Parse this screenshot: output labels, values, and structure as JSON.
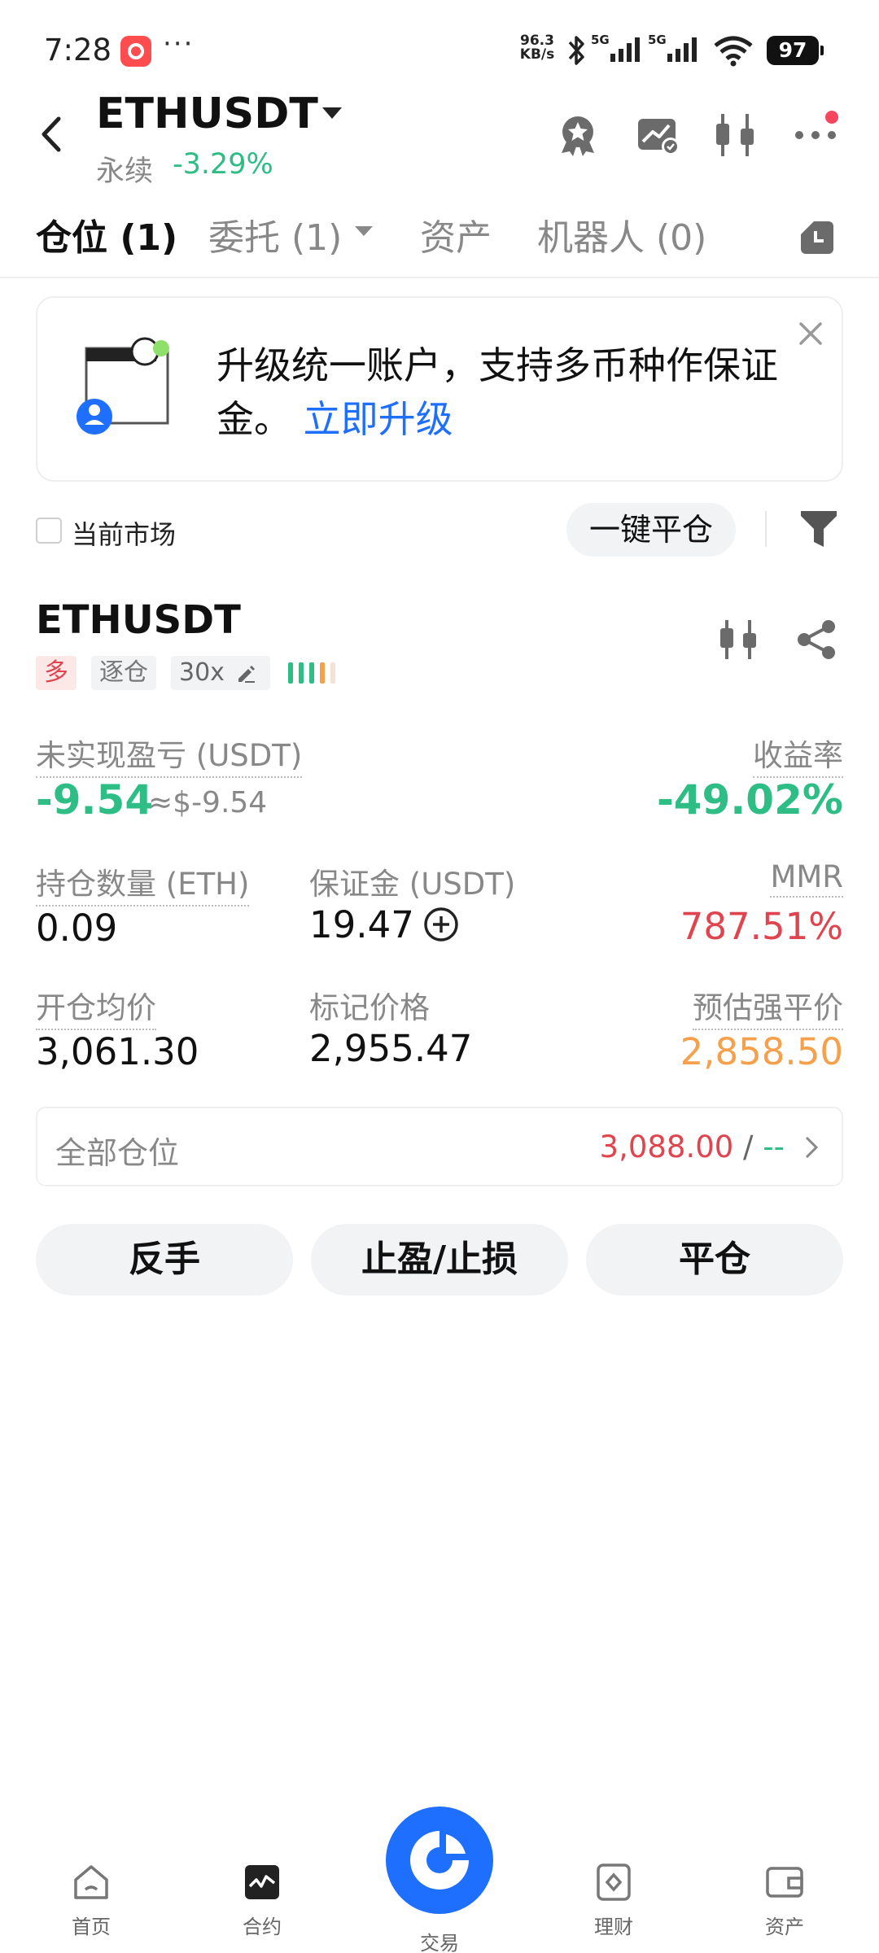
{
  "status_bar": {
    "time": "7:28",
    "more": "···",
    "net_speed_value": "96.3",
    "net_speed_unit": "KB/s",
    "signal_1": "5G",
    "signal_2": "5G",
    "battery": "97"
  },
  "header": {
    "symbol": "ETHUSDT",
    "contract_type": "永续",
    "change": "-3.29%",
    "icons": [
      "award-icon",
      "chart-trend-icon",
      "candlestick-icon",
      "more-icon"
    ]
  },
  "tabs": [
    {
      "label": "仓位 (1)",
      "active": true
    },
    {
      "label": "委托 (1)",
      "active": false
    },
    {
      "label": "资产",
      "active": false
    },
    {
      "label": "机器人 (0)",
      "active": false
    }
  ],
  "banner": {
    "text": "升级统一账户，支持多币种作保证金。",
    "link": "立即升级"
  },
  "filter": {
    "current_market": "当前市场",
    "close_all": "一键平仓"
  },
  "position": {
    "symbol": "ETHUSDT",
    "side": "多",
    "margin_mode": "逐仓",
    "leverage": "30x",
    "risk_level": 4,
    "unrealized_pnl_label": "未实现盈亏 (USDT)",
    "unrealized_pnl": "-9.54",
    "unrealized_pnl_usd": "≈$-9.54",
    "roe_label": "收益率",
    "roe": "-49.02%",
    "size_label": "持仓数量 (ETH)",
    "size": "0.09",
    "margin_label": "保证金 (USDT)",
    "margin": "19.47",
    "mmr_label": "MMR",
    "mmr": "787.51%",
    "entry_label": "开仓均价",
    "entry": "3,061.30",
    "mark_label": "标记价格",
    "mark": "2,955.47",
    "liq_label": "预估强平价",
    "liq": "2,858.50",
    "all_positions_label": "全部仓位",
    "all_positions_value": "3,088.00",
    "all_positions_sep": " / ",
    "all_positions_extra": "--"
  },
  "actions": {
    "reverse": "反手",
    "tpsl": "止盈/止损",
    "close": "平仓"
  },
  "bottom_nav": [
    {
      "label": "首页",
      "icon": "home-icon"
    },
    {
      "label": "合约",
      "icon": "futures-icon"
    },
    {
      "label": "交易",
      "icon": "trade-icon"
    },
    {
      "label": "理财",
      "icon": "earn-icon"
    },
    {
      "label": "资产",
      "icon": "wallet-icon"
    }
  ],
  "colors": {
    "green": "#2dbd85",
    "red": "#e0454f",
    "orange": "#f7a04b",
    "link_blue": "#1f6fff",
    "trade_blue": "#1f6fff"
  }
}
